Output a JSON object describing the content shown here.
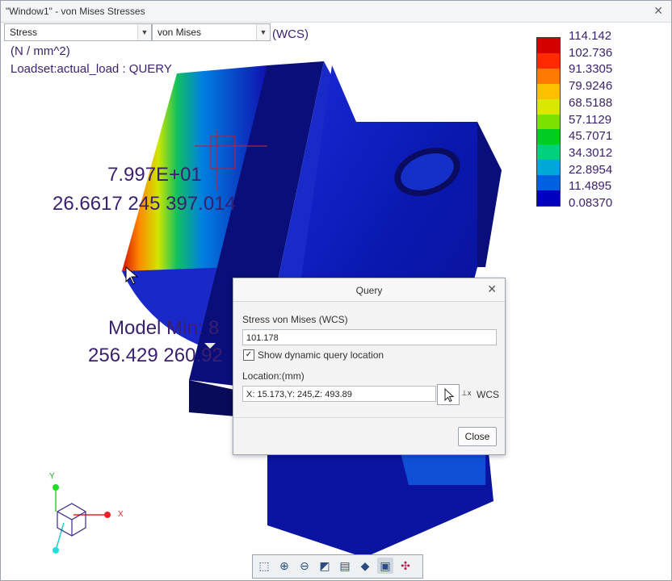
{
  "window": {
    "title": "\"Window1\" - von Mises Stresses",
    "close_symbol": "✕"
  },
  "toolbar": {
    "quantity_select": "Stress",
    "component_select": "von Mises",
    "coordinate_system": "(WCS)"
  },
  "info": {
    "units": "(N / mm^2)",
    "loadset": "Loadset:actual_load :  QUERY"
  },
  "overlays": {
    "query_value": "7.997E+01",
    "query_coords": "26.6617  245  397.014",
    "model_min_label": "Model Min: 8",
    "model_min_coords": "256.429  260.92"
  },
  "legend": {
    "values": [
      "114.142",
      "102.736",
      "91.3305",
      "79.9246",
      "68.5188",
      "57.1129",
      "45.7071",
      "34.3012",
      "22.8954",
      "11.4895",
      "0.08370"
    ],
    "colors": [
      "#d40000",
      "#ff2a00",
      "#ff7a00",
      "#ffc000",
      "#d8e800",
      "#7ee000",
      "#00cc22",
      "#00d080",
      "#00a8d8",
      "#0060e0",
      "#0000c0"
    ]
  },
  "axes": {
    "x": "X",
    "y": "Y"
  },
  "query_dialog": {
    "title": "Query",
    "close_symbol": "✕",
    "result_label": "Stress von Mises (WCS)",
    "result_value": "101.178",
    "show_location_label": "Show dynamic query location",
    "show_location_checked": true,
    "location_label": "Location:(mm)",
    "location_value": "X: 15.173,Y: 245,Z: 493.89",
    "wcs_label": "WCS",
    "close_button": "Close"
  },
  "view_tools": [
    "refit-icon",
    "zoom-in-icon",
    "zoom-out-icon",
    "repaint-icon",
    "saved-views-icon",
    "display-style-icon",
    "view-manager-icon",
    "spin-center-icon"
  ]
}
